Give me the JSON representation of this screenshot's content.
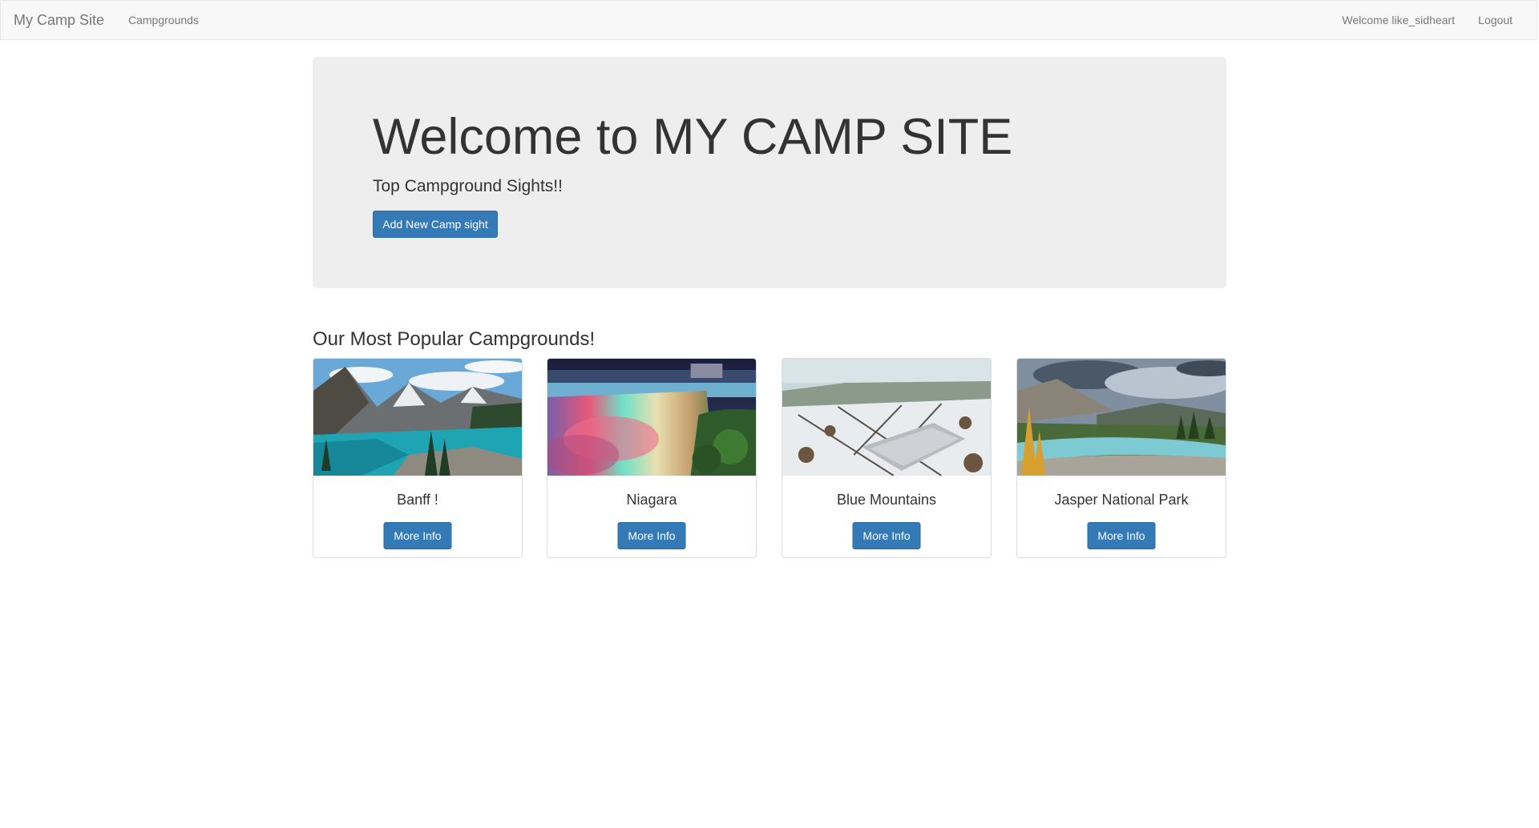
{
  "navbar": {
    "brand": "My Camp Site",
    "campgrounds_link": "Campgrounds",
    "welcome_text": "Welcome like_sidheart",
    "logout_link": "Logout"
  },
  "jumbotron": {
    "title": "Welcome to MY CAMP SITE",
    "subtitle": "Top Campground Sights!!",
    "add_button": "Add New Camp sight"
  },
  "popular": {
    "heading": "Our Most Popular Campgrounds!",
    "cards": [
      {
        "title": "Banff !",
        "button": "More Info",
        "image": "lake-mountains-photo"
      },
      {
        "title": "Niagara",
        "button": "More Info",
        "image": "waterfall-photo"
      },
      {
        "title": "Blue Mountains",
        "button": "More Info",
        "image": "ski-resort-photo"
      },
      {
        "title": "Jasper National Park",
        "button": "More Info",
        "image": "river-valley-photo"
      }
    ]
  },
  "colors": {
    "primary": "#337ab7",
    "navbar_bg": "#f8f8f8",
    "jumbotron_bg": "#eeeeee"
  }
}
